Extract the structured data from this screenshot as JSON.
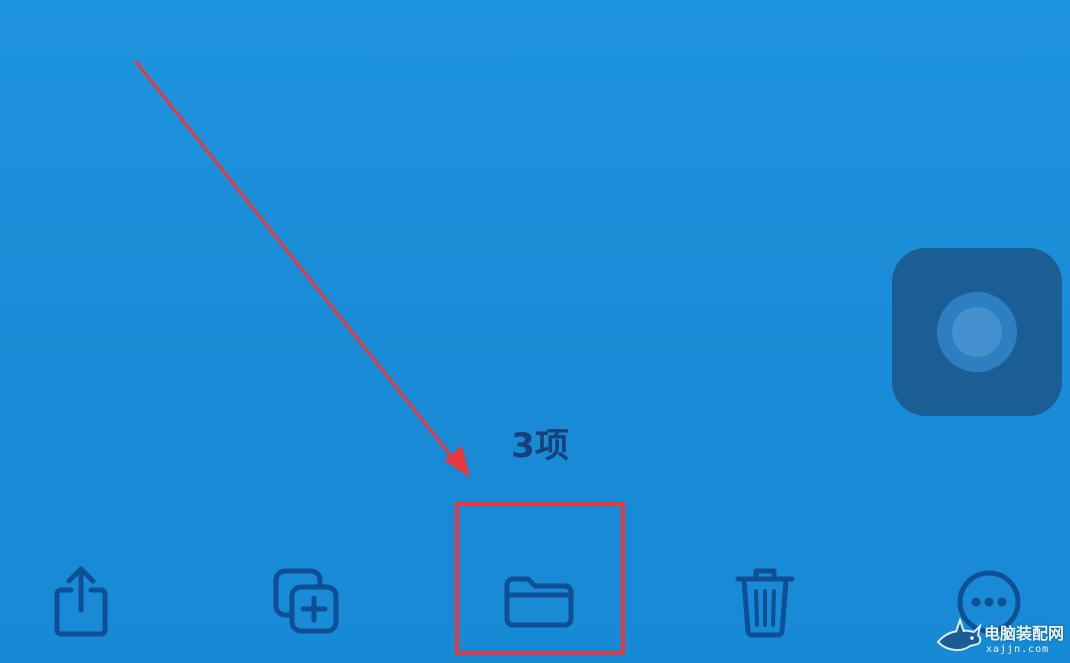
{
  "selection": {
    "count_label": "3项"
  },
  "toolbar": {
    "items": [
      {
        "name": "share",
        "icon": "share-icon"
      },
      {
        "name": "duplicate",
        "icon": "duplicate-icon"
      },
      {
        "name": "move",
        "icon": "folder-icon"
      },
      {
        "name": "delete",
        "icon": "trash-icon"
      },
      {
        "name": "more",
        "icon": "ellipsis-circle-icon"
      }
    ],
    "icon_color": "#0f4f95"
  },
  "annotation": {
    "arrow_color": "#e8383d",
    "highlight_color": "#e8383d",
    "highlighted_item": "move"
  },
  "assistive_touch": {
    "icon": "assistive-touch-icon"
  },
  "watermark": {
    "title": "电脑装配网",
    "url": "xajjn.com"
  },
  "colors": {
    "background": "#1c8ed8"
  }
}
